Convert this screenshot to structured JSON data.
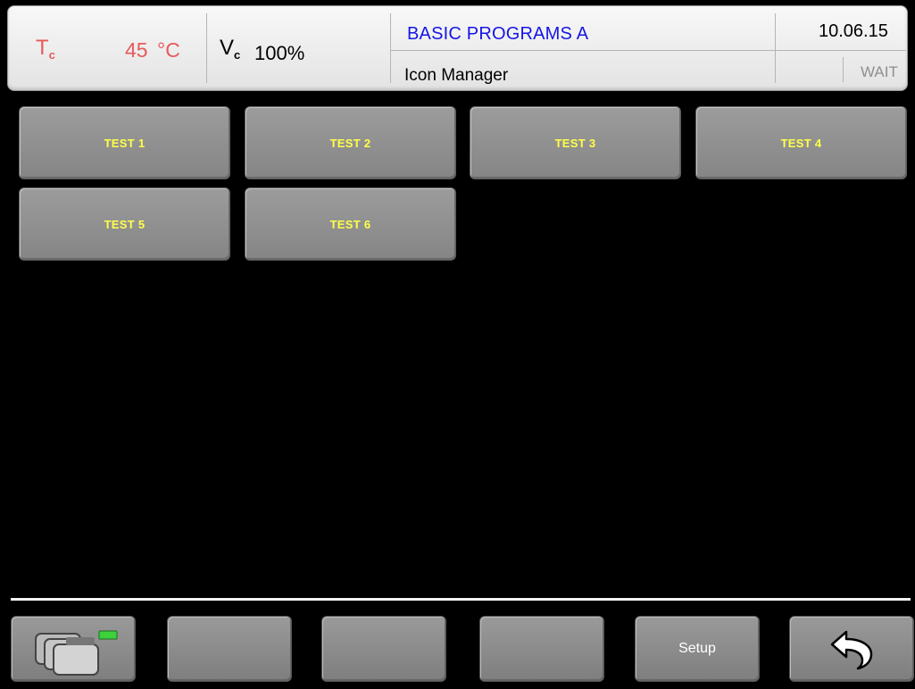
{
  "header": {
    "temp_symbol": "T",
    "temp_subscript": "c",
    "temp_value": "45",
    "temp_unit": "°C",
    "speed_symbol": "V",
    "speed_subscript": "c",
    "speed_value": "100%",
    "program_group": "BASIC PROGRAMS A",
    "screen_name": "Icon Manager",
    "date": "10.06.15",
    "status": "WAIT"
  },
  "programs": [
    {
      "label": "TEST 1"
    },
    {
      "label": "TEST 2"
    },
    {
      "label": "TEST 3"
    },
    {
      "label": "TEST 4"
    },
    {
      "label": "TEST 5"
    },
    {
      "label": "TEST 6"
    }
  ],
  "bottom_bar": {
    "left_icon": "program-cards-icon",
    "setup_label": "Setup",
    "back_icon": "back-arrow-icon"
  },
  "colors": {
    "temperature": "#e85a5a",
    "program_group": "#1515e6",
    "button_text": "#ffff4a",
    "status_led": "#3cd23c"
  }
}
